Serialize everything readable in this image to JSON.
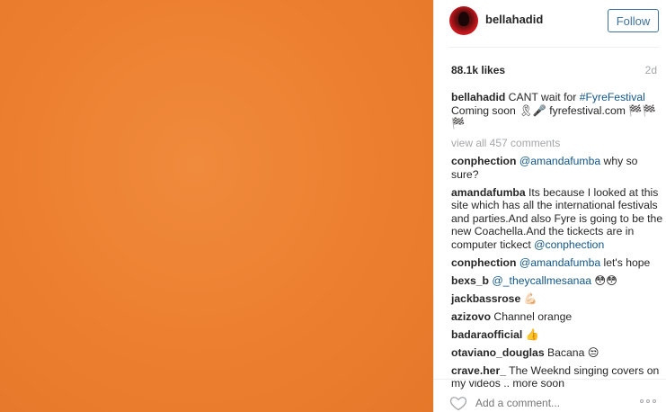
{
  "post": {
    "image_color": "#ec7f2f",
    "username": "bellahadid",
    "follow_label": "Follow",
    "likes": "88.1k likes",
    "age": "2d",
    "caption": {
      "user": "bellahadid",
      "text_a": " CANT wait for ",
      "hashtag": "#FyreFestival",
      "text_b": " Coming soon 🎗🎤 fyrefestival.com 🏁🏁 🏁"
    },
    "view_all": "view all 457 comments"
  },
  "comments": [
    {
      "user": "conphection",
      "mention": "@amandafumba",
      "text": " why so sure?"
    },
    {
      "user": "amandafumba",
      "text": " Its because I looked at this site which has all the international festivals and parties.And also Fyre is going to be the new Coachella.And the tickects are in computer tickect ",
      "mention_end": "@conphection"
    },
    {
      "user": "conphection",
      "mention": "@amandafumba",
      "text": " let's hope"
    },
    {
      "user": "bexs_b",
      "mention": "@_theycallmesanaa",
      "text": " 😳😳"
    },
    {
      "user": "jackbassrose",
      "text": " 💪🏻"
    },
    {
      "user": "azizovo",
      "text": " Channel orange"
    },
    {
      "user": "badaraofficial",
      "text": " 👍"
    },
    {
      "user": "otaviano_douglas",
      "text": " Bacana 😒"
    },
    {
      "user": "crave.her_",
      "text": " The Weeknd singing covers on my videos .. more soon"
    }
  ],
  "footer": {
    "add_comment_placeholder": "Add a comment...",
    "heart_icon": "heart-icon",
    "more_icon": "more-options-icon"
  }
}
